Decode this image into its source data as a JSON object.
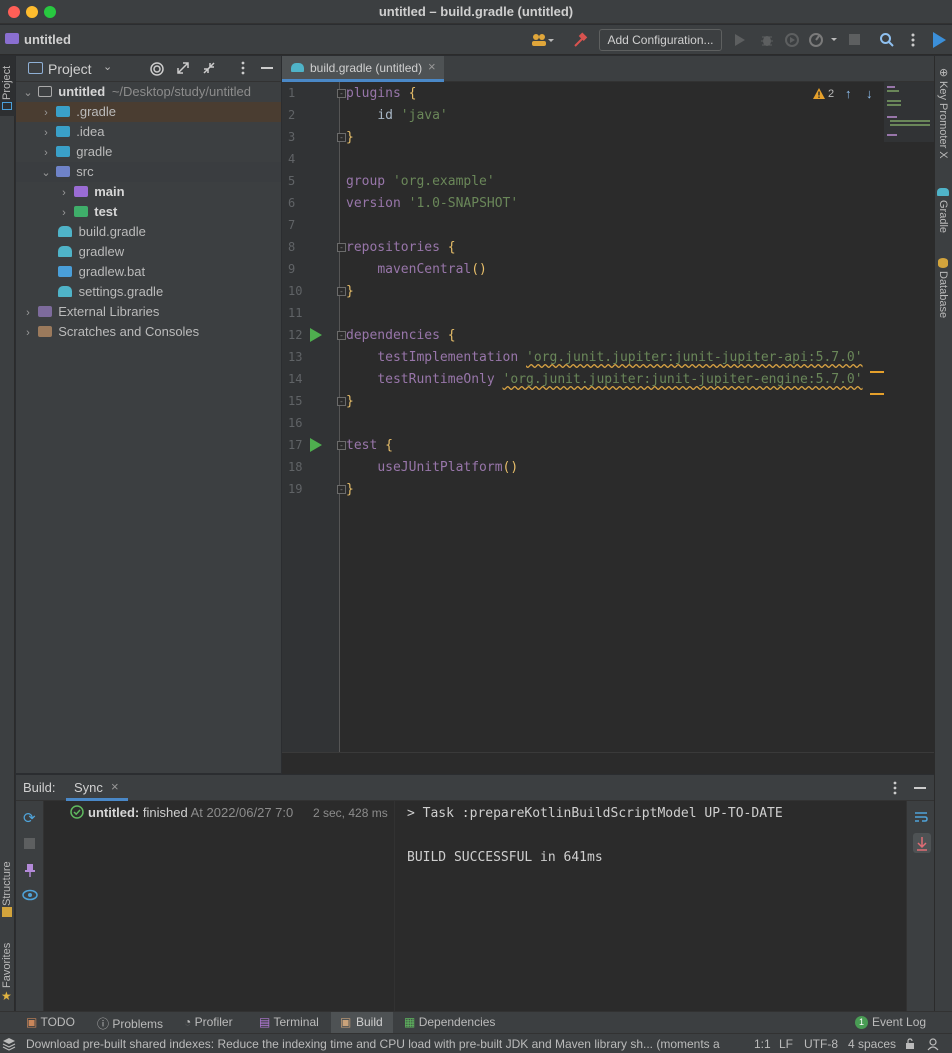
{
  "window": {
    "title": "untitled – build.gradle (untitled)"
  },
  "navbar": {
    "project": "untitled",
    "add_configuration": "Add Configuration..."
  },
  "left_stripe": {
    "project": "Project",
    "structure": "Structure",
    "favorites": "Favorites"
  },
  "right_stripe": {
    "key_promoter": "Key Promoter X",
    "gradle": "Gradle",
    "database": "Database"
  },
  "project_panel": {
    "title": "Project",
    "root": {
      "name": "untitled",
      "path": "~/Desktop/study/untitled"
    },
    "items": [
      {
        "label": ".gradle",
        "depth": 1,
        "expanded": false
      },
      {
        "label": ".idea",
        "depth": 1,
        "expanded": false
      },
      {
        "label": "gradle",
        "depth": 1,
        "expanded": false
      },
      {
        "label": "src",
        "depth": 1,
        "expanded": true
      },
      {
        "label": "main",
        "depth": 2,
        "expanded": false
      },
      {
        "label": "test",
        "depth": 2,
        "expanded": false
      },
      {
        "label": "build.gradle",
        "depth": 1
      },
      {
        "label": "gradlew",
        "depth": 1
      },
      {
        "label": "gradlew.bat",
        "depth": 1
      },
      {
        "label": "settings.gradle",
        "depth": 1
      }
    ],
    "external_libraries": "External Libraries",
    "scratches": "Scratches and Consoles"
  },
  "editor": {
    "tab": "build.gradle (untitled)",
    "warnings": "2",
    "lines": [
      "1",
      "2",
      "3",
      "4",
      "5",
      "6",
      "7",
      "8",
      "9",
      "10",
      "11",
      "12",
      "13",
      "14",
      "15",
      "16",
      "17",
      "18",
      "19"
    ],
    "code": {
      "plugins": "plugins",
      "id": "id",
      "java": "'java'",
      "group_kw": "group",
      "group_val": "'org.example'",
      "version_kw": "version",
      "version_val": "'1.0-SNAPSHOT'",
      "repositories": "repositories",
      "maven": "mavenCentral",
      "dependencies": "dependencies",
      "testImpl": "testImplementation",
      "testImpl_val": "'org.junit.jupiter:junit-jupiter-api:5.7.0'",
      "testRuntime": "testRuntimeOnly",
      "testRuntime_val": "'org.junit.jupiter:junit-jupiter-engine:5.7.0'",
      "test": "test",
      "useJUnit": "useJUnitPlatform"
    }
  },
  "build_panel": {
    "label": "Build:",
    "tab": "Sync",
    "tree_name": "untitled:",
    "tree_status": "finished",
    "tree_time": "At 2022/06/27 7:0",
    "tree_duration": "2 sec, 428 ms",
    "console_line1": "> Task :prepareKotlinBuildScriptModel UP-TO-DATE",
    "console_line2": "BUILD SUCCESSFUL in 641ms"
  },
  "toolbar": {
    "todo": "TODO",
    "problems": "Problems",
    "profiler": "Profiler",
    "terminal": "Terminal",
    "build": "Build",
    "dependencies": "Dependencies",
    "event_log": "Event Log",
    "event_count": "1"
  },
  "statusbar": {
    "message": "Download pre-built shared indexes: Reduce the indexing time and CPU load with pre-built JDK and Maven library sh... (moments ago)",
    "position": "1:1",
    "line_sep": "LF",
    "encoding": "UTF-8",
    "indent": "4 spaces"
  }
}
